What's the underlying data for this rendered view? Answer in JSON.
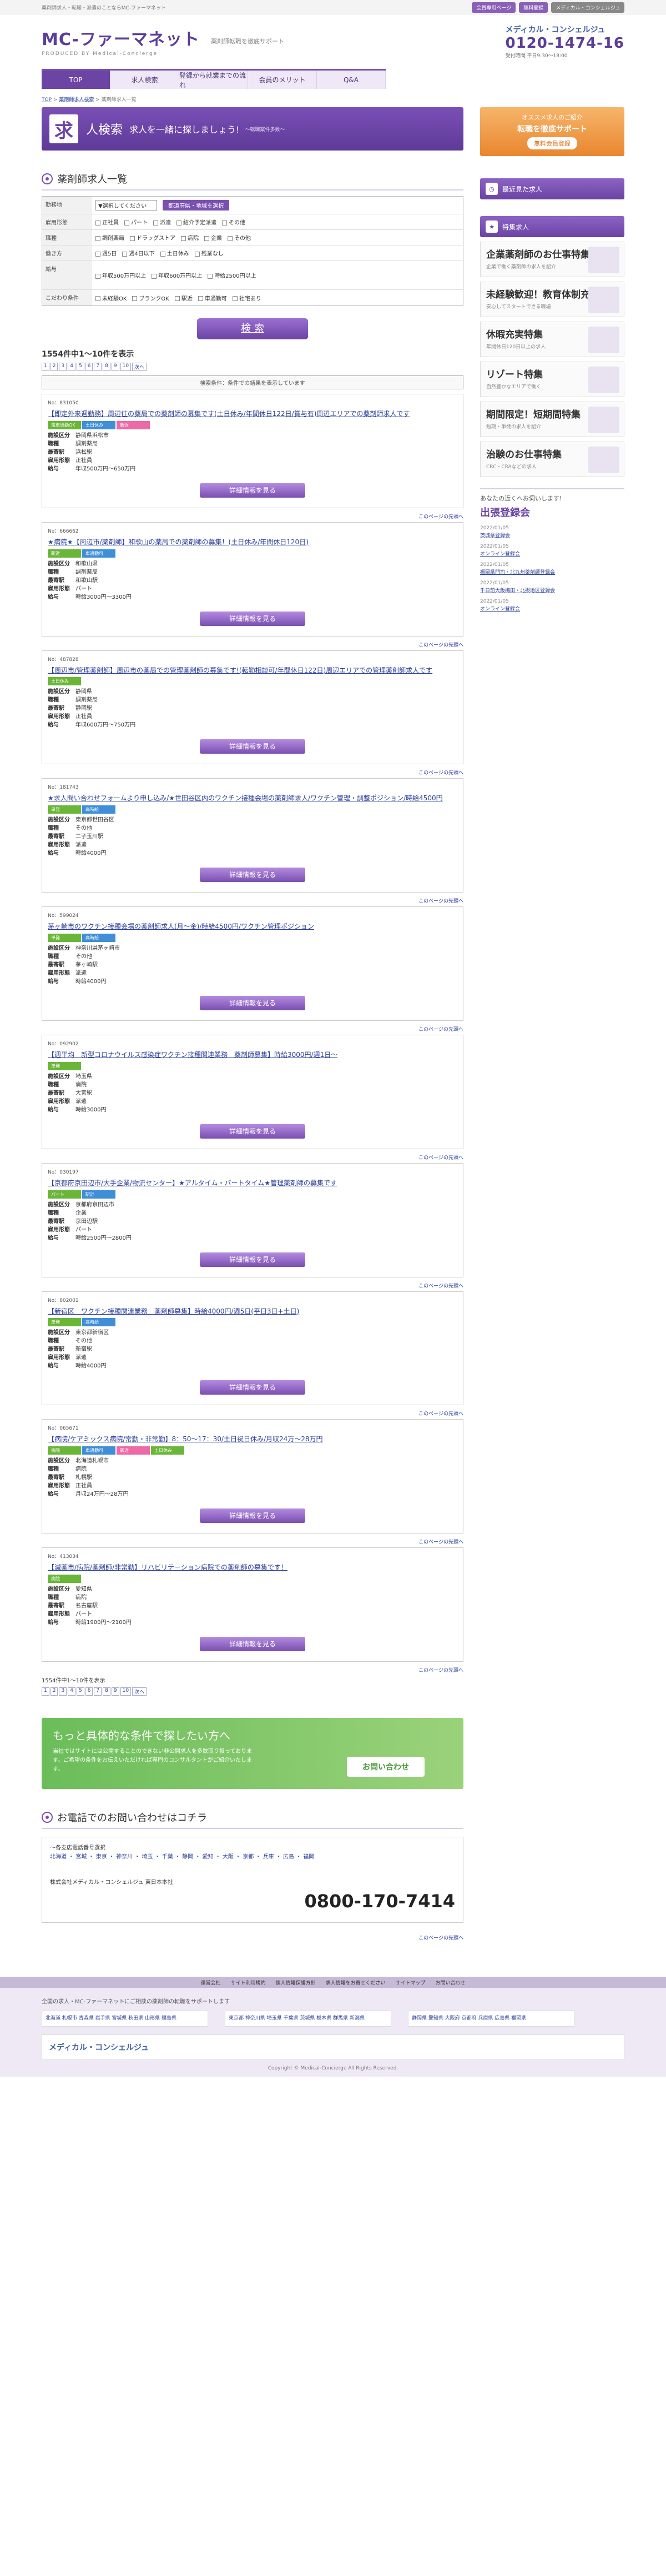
{
  "top": {
    "tagline": "薬剤師求人・転職・派遣のことならMC-ファーマネット",
    "btn_mypage": "会員専用ページ",
    "btn_register": "無料登録",
    "btn_en": "メディカル・コンシェルジュ"
  },
  "header": {
    "logo": "MC-ファーマネット",
    "logo_sub": "PRODUCED BY Medical-Concierge",
    "logo_tag": "薬剤師転職を徹底サポート",
    "brand": "メディカル・コンシェルジュ",
    "phone": "0120-1474-16",
    "phone_note": "受付時間 平日9:30〜18:00"
  },
  "nav": [
    "TOP",
    "求人検索",
    "登録から就業までの流れ",
    "会員のメリット",
    "Q&A"
  ],
  "breadcrumb": [
    "TOP",
    "薬剤師求人検索",
    "薬剤師求人一覧"
  ],
  "hero": {
    "char": "求",
    "title": "人検索",
    "sub": "求人を一緒に探しましょう!",
    "note": "〜転職案件多数〜"
  },
  "list_heading": "薬剤師求人一覧",
  "form": {
    "rows": [
      {
        "label": "勤務地",
        "values": [
          "▼選択してください",
          "都道府県・地域を選択"
        ]
      },
      {
        "label": "雇用形態",
        "values": [
          "正社員",
          "パート",
          "派遣",
          "紹介予定派遣",
          "その他"
        ]
      },
      {
        "label": "職種",
        "values": [
          "調剤薬局",
          "ドラッグストア",
          "病院",
          "企業",
          "その他"
        ]
      },
      {
        "label": "働き方",
        "values": [
          "週5日",
          "週4日以下",
          "土日休み",
          "残業なし"
        ]
      },
      {
        "label": "給与",
        "values": [
          "年収500万円以上",
          "年収600万円以上",
          "時給2500円以上"
        ]
      },
      {
        "label": "こだわり条件",
        "values": [
          "未経験OK",
          "ブランクOK",
          "駅近",
          "車通勤可",
          "社宅あり"
        ]
      }
    ],
    "search_label": "検 索"
  },
  "result_count": "1554件中1～10件を表示",
  "pager": [
    "1",
    "2",
    "3",
    "4",
    "5",
    "6",
    "7",
    "8",
    "9",
    "10",
    "次へ"
  ],
  "notice": "検索条件：条件での結果を表示しています",
  "jobs": [
    {
      "no": "No：831050",
      "title": "【即定外来週勤務】周辺住の薬局での薬剤師の募集です(土日休み/年間休日122日/賞与有)周辺エリアでの薬剤師求人です",
      "badges": [
        "電車通勤OK",
        "土日休み",
        "駅近"
      ],
      "area": "静岡県浜松市",
      "type": "正社員",
      "station": "浜松駅",
      "salary": "年収500万円～650万円",
      "place": "調剤薬局"
    },
    {
      "no": "No：666662",
      "title": "★病院★【周辺市/薬剤師】和歌山の薬局での薬剤師の募集！(土日休み/年間休日120日)",
      "badges": [
        "駅近",
        "車通勤可"
      ],
      "area": "和歌山県",
      "type": "パート",
      "station": "和歌山駅",
      "salary": "時給3000円～3300円",
      "place": "調剤薬局"
    },
    {
      "no": "No：487828",
      "title": "【周辺市/管理薬剤師】周辺市の薬局での管理薬剤師の募集です!(転勤相談可/年間休日122日)周辺エリアでの管理薬剤師求人です",
      "badges": [
        "土日休み"
      ],
      "area": "静岡県",
      "type": "正社員",
      "station": "静岡駅",
      "salary": "年収600万円～750万円",
      "place": "調剤薬局"
    },
    {
      "no": "No：181743",
      "title": "★求人問い合わせフォームより申し込み/★世田谷区内のワクチン接種会場の薬剤師求人/ワクチン管理・調整ポジション/時給4500円",
      "badges": [
        "単発",
        "高時給"
      ],
      "area": "東京都世田谷区",
      "type": "派遣",
      "station": "二子玉川駅",
      "salary": "時給4000円",
      "place": "その他"
    },
    {
      "no": "No：599024",
      "title": "茅ヶ崎市のワクチン接種会場の薬剤師求人(月～金)/時給4500円/ワクチン管理ポジション",
      "badges": [
        "単発",
        "高時給"
      ],
      "area": "神奈川県茅ヶ崎市",
      "type": "派遣",
      "station": "茅ヶ崎駅",
      "salary": "時給4000円",
      "place": "その他"
    },
    {
      "no": "No：092902",
      "title": "【週平均　新型コロナウイルス感染症ワクチン接種関連業務　薬剤師募集】時給3000円/週1日～",
      "badges": [
        "単発"
      ],
      "area": "埼玉県",
      "type": "派遣",
      "station": "大宮駅",
      "salary": "時給3000円",
      "place": "病院"
    },
    {
      "no": "No：030197",
      "title": "【京都府京田辺市/大手企業/物流センター】★アルタイム・パートタイム★管理薬剤師の募集です",
      "badges": [
        "パート",
        "駅近"
      ],
      "area": "京都府京田辺市",
      "type": "パート",
      "station": "京田辺駅",
      "salary": "時給2500円～2800円",
      "place": "企業"
    },
    {
      "no": "No：802001",
      "title": "【新宿区　ワクチン接種関連業務　薬剤師募集】時給4000円/週5日(平日3日+土日)",
      "badges": [
        "単発",
        "高時給"
      ],
      "area": "東京都新宿区",
      "type": "派遣",
      "station": "新宿駅",
      "salary": "時給4000円",
      "place": "その他"
    },
    {
      "no": "No：065671",
      "title": "【病院/ケアミックス病院/常勤・非常勤】8：50～17：30/土日祝日休み/月収24万～28万円",
      "badges": [
        "病院",
        "車通勤可",
        "駅近",
        "土日休み"
      ],
      "area": "北海道札幌市",
      "type": "正社員",
      "station": "札幌駅",
      "salary": "月収24万円～28万円",
      "place": "病院"
    },
    {
      "no": "No：413034",
      "title": "【減薬市/病院/薬剤師/非常勤】リハビリテーション病院での薬剤師の募集です！",
      "badges": [
        "病院"
      ],
      "area": "愛知県",
      "type": "パート",
      "station": "名古屋駅",
      "salary": "時給1900円～2100円",
      "place": "病院"
    }
  ],
  "job_labels": {
    "area": "施設区分",
    "type": "雇用形態",
    "station": "最寄駅",
    "salary": "給与",
    "place": "職種",
    "detail": "詳細情報を見る",
    "pagetop": "このページの先頭へ"
  },
  "bottom_count": "1554件中1～10件を表示",
  "banner2": {
    "title": "もっと具体的な条件で探したい方へ",
    "sub": "当社ではサイトには公開することのできない非公開求人を多数取り扱っております。ご希望の条件をお伝えいただければ専門のコンサルタントがご紹介いたします。",
    "btn": "お問い合わせ"
  },
  "tel_heading": "お電話でのお問い合わせはコチラ",
  "tel_block": {
    "label": "～各支店電話番号選択",
    "areas": "北海道 ・ 宮城 ・ 東京 ・ 神奈川 ・ 埼玉 ・ 千葉 ・ 静岡 ・ 愛知 ・ 大阪 ・ 京都 ・ 兵庫 ・ 広島 ・ 福岡",
    "company": "株式会社メディカル・コンシェルジュ 東日本本社",
    "number": "0800-170-7414"
  },
  "sidebar": {
    "ad": {
      "a": "オススメ求人のご紹介",
      "b": "転職を徹底サポート",
      "c": "無料会員登録"
    },
    "recent": "最近見た求人",
    "feature": "特集求人",
    "banners": [
      {
        "t": "企業薬剤師のお仕事特集",
        "s": "企業で働く薬剤師の求人を紹介"
      },
      {
        "t": "未経験歓迎！教育体制充実特集",
        "s": "安心してスタートできる職場"
      },
      {
        "t": "休暇充実特集",
        "s": "年間休日120日以上の求人"
      },
      {
        "t": "リゾート特集",
        "s": "自然豊かなエリアで働く"
      },
      {
        "t": "期間限定！短期間特集",
        "s": "短期・単発の求人を紹介"
      },
      {
        "t": "治験のお仕事特集",
        "s": "CRC・CRAなどの求人"
      }
    ],
    "visit_t": "あなたの近くへお伺いします!",
    "visit_h": "出張登録会",
    "visit_list": [
      {
        "d": "2022/01/05",
        "t": "茨城県登録会"
      },
      {
        "d": "2022/01/05",
        "t": "オンライン登録会"
      },
      {
        "d": "2022/01/05",
        "t": "福岡県門司・北九州薬剤師登録会"
      },
      {
        "d": "2022/01/05",
        "t": "千日前大阪梅田・北摂地区登録会"
      },
      {
        "d": "2022/01/05",
        "t": "オンライン登録会"
      }
    ]
  },
  "footer": {
    "links": [
      "運営会社",
      "サイト利用規約",
      "個人情報保護方針",
      "求人情報をお寄せください",
      "サイトマップ",
      "お問い合わせ"
    ],
    "title": "全国の求人・MC-ファーマネットにご相談の薬剤師の転職をサポートします",
    "col1": "北海道 札幌市 青森県 岩手県 宮城県 秋田県 山形県 福島県",
    "col2": "東京都 神奈川県 埼玉県 千葉県 茨城県 栃木県 群馬県 新潟県",
    "col3": "静岡県 愛知県 大阪府 京都府 兵庫県 広島県 福岡県",
    "brand": "メディカル・コンシェルジュ",
    "copy": "Copyright © Medical-Concierge All Rights Reserved."
  },
  "colors": {
    "brand": "#6b44a4",
    "accent": "#7a4fb0",
    "green": "#6ab638"
  }
}
